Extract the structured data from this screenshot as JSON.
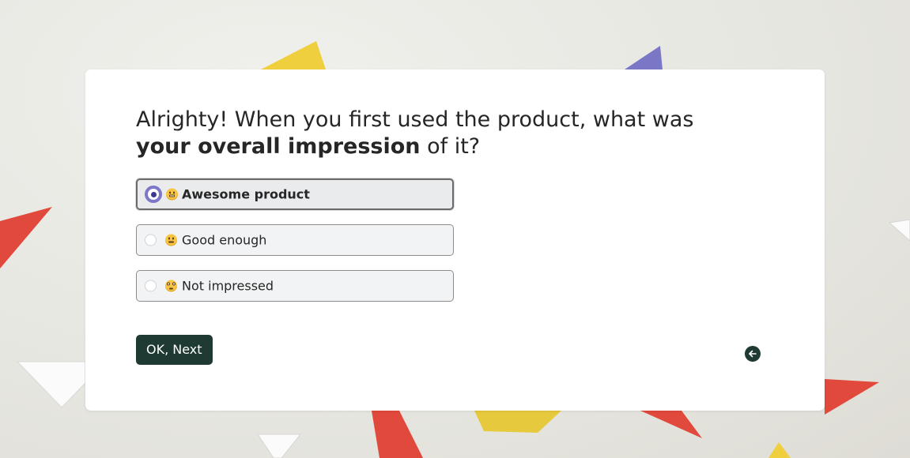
{
  "question": {
    "prefix": "Alrighty! When you first used the product, what was ",
    "emphasis": "your overall impression",
    "suffix": " of it?"
  },
  "options": [
    {
      "emoji": "grinning-face-icon",
      "label": "Awesome product",
      "selected": true
    },
    {
      "emoji": "neutral-face-icon",
      "label": "Good enough",
      "selected": false
    },
    {
      "emoji": "face-with-rolling-eyes-icon",
      "label": "Not impressed",
      "selected": false
    }
  ],
  "actions": {
    "next_label": "OK, Next",
    "back_icon": "arrow-left-icon"
  },
  "colors": {
    "accent": "#1f3a32",
    "radio_selected": "#7d77c9",
    "card": "#ffffff",
    "confetti": [
      "#e0493b",
      "#f0cf3f",
      "#7a78c6",
      "#ffffff"
    ]
  }
}
